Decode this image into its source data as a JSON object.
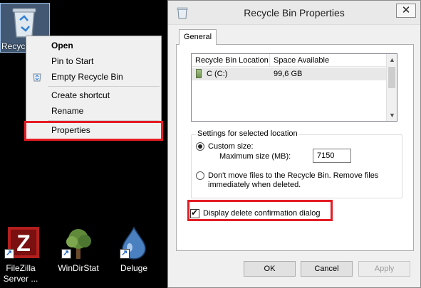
{
  "desktop": {
    "recycle_label": "Recycl",
    "icons": [
      {
        "label_line1": "FileZilla",
        "label_line2": "Server ..."
      },
      {
        "label_line1": "WinDirStat",
        "label_line2": ""
      },
      {
        "label_line1": "Deluge",
        "label_line2": ""
      }
    ]
  },
  "context_menu": {
    "items": [
      {
        "label": "Open"
      },
      {
        "label": "Pin to Start"
      },
      {
        "label": "Empty Recycle Bin"
      },
      {
        "label": "Create shortcut"
      },
      {
        "label": "Rename"
      },
      {
        "label": "Properties"
      }
    ]
  },
  "dialog": {
    "title": "Recycle Bin Properties",
    "close_glyph": "✕",
    "tab_label": "General",
    "list": {
      "columns": [
        "Recycle Bin Location",
        "Space Available"
      ],
      "rows": [
        {
          "location": "C (C:)",
          "space": "99,6 GB"
        }
      ]
    },
    "settings_group_title": "Settings for selected location",
    "custom_size_label": "Custom size:",
    "max_size_label": "Maximum size (MB):",
    "max_size_value": "7150",
    "no_move_line1": "Don't move files to the Recycle Bin. Remove files",
    "no_move_line2": "immediately when deleted.",
    "confirm_label": "Display delete confirmation dialog",
    "buttons": {
      "ok": "OK",
      "cancel": "Cancel",
      "apply": "Apply"
    }
  },
  "colors": {
    "highlight": "#e51c24",
    "selection": "#e8e8e8"
  }
}
